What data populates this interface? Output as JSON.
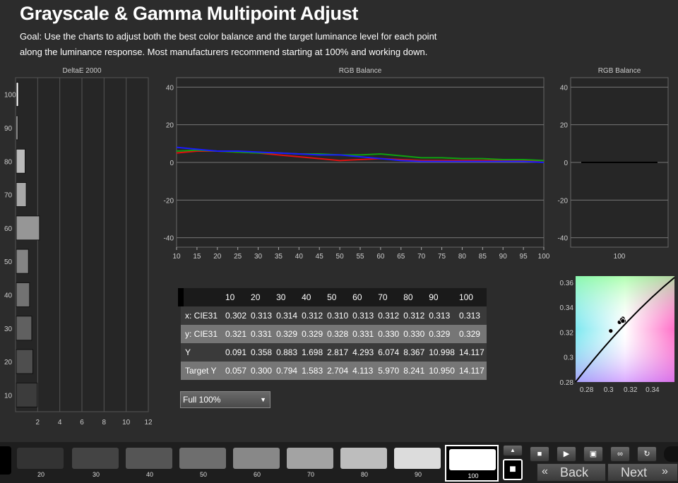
{
  "header": {
    "title": "Grayscale &  Gamma Multipoint Adjust",
    "goal_line1": "Goal: Use the charts to adjust both the best color balance and the target luminance level for each point",
    "goal_line2": "along the luminance response. Most manufacturers recommend starting at 100% and working down."
  },
  "chart_data": [
    {
      "type": "bar",
      "orientation": "horizontal",
      "title": "DeltaE 2000",
      "categories": [
        "10",
        "20",
        "30",
        "40",
        "50",
        "60",
        "70",
        "80",
        "90",
        "100"
      ],
      "values": [
        1.9,
        1.5,
        1.4,
        1.2,
        1.1,
        2.1,
        0.9,
        0.8,
        0.1,
        0.2
      ],
      "xlim": [
        0,
        12
      ],
      "xticks": [
        "2",
        "4",
        "6",
        "8",
        "10",
        "12"
      ],
      "grid": true
    },
    {
      "type": "line",
      "title": "RGB Balance",
      "x": [
        10,
        15,
        20,
        25,
        30,
        35,
        40,
        45,
        50,
        55,
        60,
        65,
        70,
        75,
        80,
        85,
        90,
        95,
        100
      ],
      "ylim": [
        -45,
        45
      ],
      "yticks": [
        "40",
        "20",
        "0",
        "-20",
        "-40"
      ],
      "xticks": [
        "10",
        "15",
        "20",
        "25",
        "30",
        "35",
        "40",
        "45",
        "50",
        "55",
        "60",
        "65",
        "70",
        "75",
        "80",
        "85",
        "90",
        "95",
        "100"
      ],
      "series": [
        {
          "color": "#e01010",
          "values": [
            5,
            6,
            6,
            5.5,
            5,
            4,
            3,
            2,
            1,
            1.5,
            2,
            1.5,
            1,
            1,
            1,
            1,
            1,
            1,
            1
          ]
        },
        {
          "color": "#10a010",
          "values": [
            6,
            6.5,
            6,
            5.5,
            5,
            5,
            4.5,
            4.5,
            4,
            4,
            4.5,
            3.5,
            2.5,
            2.5,
            2,
            2,
            1.5,
            1.5,
            1
          ]
        },
        {
          "color": "#1a1aff",
          "values": [
            8,
            7,
            6,
            6,
            5.5,
            5,
            4.5,
            4,
            4,
            3,
            2,
            1,
            0.5,
            0.5,
            0.5,
            0.5,
            0.5,
            0.5,
            0
          ]
        }
      ],
      "grid": true
    },
    {
      "type": "line",
      "title": "RGB Balance",
      "x": [
        "100"
      ],
      "ylim": [
        -45,
        45
      ],
      "yticks": [
        "40",
        "20",
        "0",
        "-20",
        "-40"
      ],
      "xticks": [
        "100"
      ],
      "series": [
        {
          "color": "#000000",
          "values": [
            0
          ]
        }
      ],
      "grid": true
    },
    {
      "type": "scatter",
      "title": "",
      "xlim": [
        0.27,
        0.36
      ],
      "ylim": [
        0.28,
        0.365
      ],
      "xticks": [
        "0.28",
        "0.3",
        "0.32",
        "0.34"
      ],
      "yticks": [
        "0.36",
        "0.34",
        "0.32",
        "0.3",
        "0.28"
      ],
      "points": [
        {
          "x": 0.302,
          "y": 0.321
        },
        {
          "x": 0.313,
          "y": 0.331
        },
        {
          "x": 0.314,
          "y": 0.329
        },
        {
          "x": 0.312,
          "y": 0.329
        },
        {
          "x": 0.31,
          "y": 0.328
        },
        {
          "x": 0.313,
          "y": 0.331
        },
        {
          "x": 0.312,
          "y": 0.33
        },
        {
          "x": 0.312,
          "y": 0.33
        },
        {
          "x": 0.313,
          "y": 0.329
        },
        {
          "x": 0.313,
          "y": 0.329
        }
      ]
    }
  ],
  "table": {
    "headers": [
      "",
      "10",
      "20",
      "30",
      "40",
      "50",
      "60",
      "70",
      "80",
      "90",
      "100"
    ],
    "rows": [
      {
        "label": "x: CIE31",
        "values": [
          "0.302",
          "0.313",
          "0.314",
          "0.312",
          "0.310",
          "0.313",
          "0.312",
          "0.312",
          "0.313",
          "0.313"
        ]
      },
      {
        "label": "y: CIE31",
        "values": [
          "0.321",
          "0.331",
          "0.329",
          "0.329",
          "0.328",
          "0.331",
          "0.330",
          "0.330",
          "0.329",
          "0.329"
        ]
      },
      {
        "label": "Y",
        "values": [
          "0.091",
          "0.358",
          "0.883",
          "1.698",
          "2.817",
          "4.293",
          "6.074",
          "8.367",
          "10.998",
          "14.117"
        ]
      },
      {
        "label": "Target Y",
        "values": [
          "0.057",
          "0.300",
          "0.794",
          "1.583",
          "2.704",
          "4.113",
          "5.970",
          "8.241",
          "10.950",
          "14.117"
        ]
      }
    ]
  },
  "level_select": {
    "value": "Full  100%"
  },
  "swatches": [
    {
      "label": "20",
      "color": "#333333"
    },
    {
      "label": "30",
      "color": "#444444"
    },
    {
      "label": "40",
      "color": "#555555"
    },
    {
      "label": "50",
      "color": "#6e6e6e"
    },
    {
      "label": "60",
      "color": "#888888"
    },
    {
      "label": "70",
      "color": "#a3a3a3"
    },
    {
      "label": "80",
      "color": "#bdbdbd"
    },
    {
      "label": "90",
      "color": "#dcdcdc"
    },
    {
      "label": "100",
      "color": "#ffffff"
    }
  ],
  "nav": {
    "back": "Back",
    "next": "Next"
  },
  "icons": {
    "stop": "■",
    "play": "▶",
    "save": "▣",
    "infinity": "∞",
    "refresh": "↻",
    "up": "▲",
    "back_arrows": "«",
    "next_arrows": "»"
  }
}
